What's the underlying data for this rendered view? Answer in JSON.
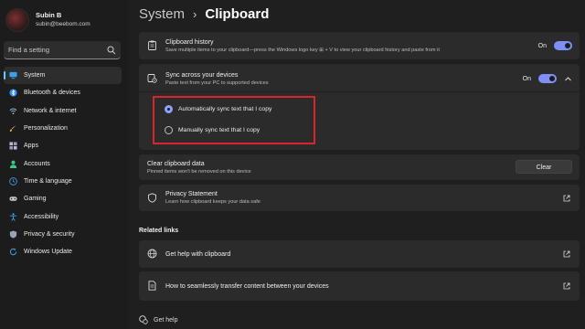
{
  "profile": {
    "name": "Subin B",
    "email": "subin@beebom.com"
  },
  "search": {
    "placeholder": "Find a setting"
  },
  "nav": {
    "items": [
      {
        "label": "System",
        "icon": "monitor-icon",
        "color": "#3aa0f0"
      },
      {
        "label": "Bluetooth & devices",
        "icon": "bluetooth-icon",
        "color": "#3a8ff0"
      },
      {
        "label": "Network & internet",
        "icon": "wifi-icon",
        "color": "#9ab6d6"
      },
      {
        "label": "Personalization",
        "icon": "brush-icon",
        "color": "#e89a4a"
      },
      {
        "label": "Apps",
        "icon": "apps-icon",
        "color": "#b9b9d9"
      },
      {
        "label": "Accounts",
        "icon": "person-icon",
        "color": "#3ac98a"
      },
      {
        "label": "Time & language",
        "icon": "globe-clock-icon",
        "color": "#3a9be0"
      },
      {
        "label": "Gaming",
        "icon": "gamepad-icon",
        "color": "#c9c9c9"
      },
      {
        "label": "Accessibility",
        "icon": "accessibility-icon",
        "color": "#3aa5f0"
      },
      {
        "label": "Privacy & security",
        "icon": "shield-icon",
        "color": "#9aa3b3"
      },
      {
        "label": "Windows Update",
        "icon": "update-icon",
        "color": "#3a9be0"
      }
    ]
  },
  "breadcrumb": {
    "parent": "System",
    "current": "Clipboard"
  },
  "history": {
    "title": "Clipboard history",
    "subtitle": "Save multiple items to your clipboard—press the Windows logo key ⊞ + V to view your clipboard history and paste from it",
    "toggle_label": "On"
  },
  "sync": {
    "title": "Sync across your devices",
    "subtitle": "Paste text from your PC to supported devices",
    "toggle_label": "On",
    "options": [
      {
        "label": "Automatically sync text that I copy",
        "selected": true
      },
      {
        "label": "Manually sync text that I copy",
        "selected": false
      }
    ]
  },
  "clear": {
    "title": "Clear clipboard data",
    "subtitle": "Pinned items won't be removed on this device",
    "button_label": "Clear"
  },
  "privacy": {
    "title": "Privacy Statement",
    "subtitle": "Learn how clipboard keeps your data safe"
  },
  "related": {
    "heading": "Related links",
    "links": [
      {
        "label": "Get help with clipboard"
      },
      {
        "label": "How to seamlessly transfer content between your devices"
      }
    ]
  },
  "footer": {
    "help_label": "Get help"
  },
  "colors": {
    "accent": "#7f8ff8",
    "highlight_border": "#d8242b"
  }
}
